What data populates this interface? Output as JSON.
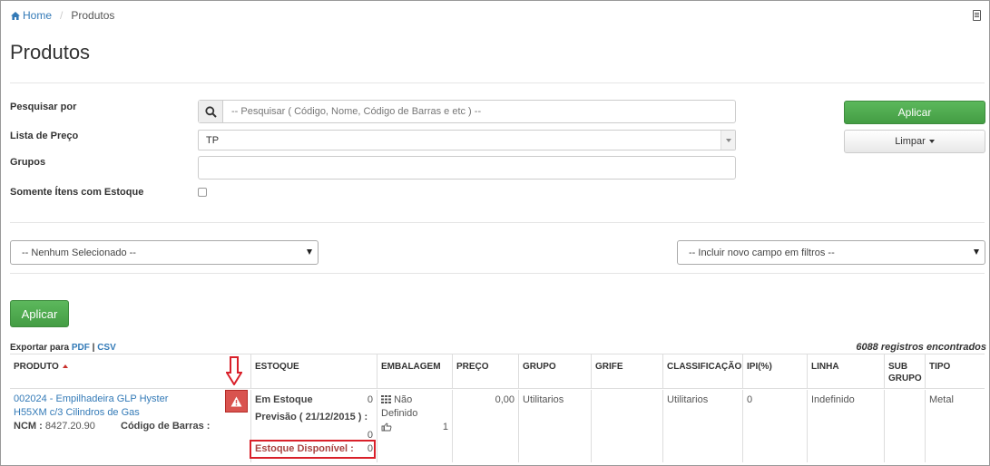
{
  "breadcrumb": {
    "home": "Home",
    "current": "Produtos"
  },
  "page": {
    "title": "Produtos"
  },
  "filters": {
    "search_label": "Pesquisar por",
    "search_placeholder": "-- Pesquisar ( Código, Nome, Código de Barras e etc ) --",
    "price_list_label": "Lista de Preço",
    "price_list_value": "TP",
    "groups_label": "Grupos",
    "groups_value": "",
    "stock_only_label": "Somente Ítens com Estoque",
    "stock_only_checked": false,
    "apply_label": "Aplicar",
    "clear_label": "Limpar",
    "none_selected": "-- Nenhum Selecionado --",
    "add_field": "-- Incluir novo campo em filtros --",
    "apply_main_label": "Aplicar"
  },
  "export": {
    "prefix": "Exportar para",
    "pdf": "PDF",
    "sep": "|",
    "csv": "CSV"
  },
  "records_found": "6088 registros encontrados",
  "table": {
    "headers": {
      "produto": "PRODUTO",
      "estoque": "ESTOQUE",
      "embalagem": "EMBALAGEM",
      "preco": "PREÇO",
      "grupo": "GRUPO",
      "grife": "GRIFE",
      "classificacao": "CLASSIFICAÇÃO",
      "ipi": "IPI(%)",
      "linha": "LINHA",
      "subgrupo_1": "SUB",
      "subgrupo_2": "GRUPO",
      "tipo": "TIPO"
    },
    "rows": [
      {
        "product_line1": "002024 - Empilhadeira GLP Hyster",
        "product_line2": "H55XM c/3 Cilindros de Gas",
        "ncm_label": "NCM :",
        "ncm_value": "8427.20.90",
        "barcode_label": "Código de Barras :",
        "in_stock_label": "Em Estoque",
        "in_stock_value": "0",
        "forecast_label": "Previsão ( 21/12/2015 ) :",
        "forecast_value": "0",
        "available_label": "Estoque Disponível :",
        "available_value": "0",
        "packaging_1": "Não",
        "packaging_2": "Definido",
        "packaging_qty": "1",
        "price": "0,00",
        "group": "Utilitarios",
        "grife": "",
        "classification": "Utilitarios",
        "ipi": "0",
        "line": "Indefinido",
        "subgroup": "",
        "type": "Metal"
      }
    ]
  },
  "colors": {
    "accent": "#337ab7",
    "success": "#5cb85c",
    "danger": "#d9534f"
  }
}
